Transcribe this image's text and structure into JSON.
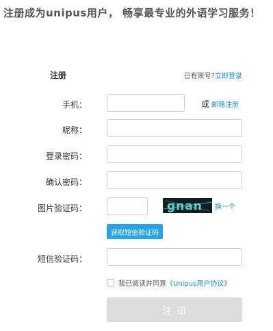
{
  "header": {
    "headline": "注册成为unipus用户， 畅享最专业的外语学习服务！"
  },
  "form": {
    "title": "注册",
    "login_hint": "已有账号?",
    "login_link": "立即登录",
    "labels": {
      "phone": "手机：",
      "nickname": "昵称：",
      "password": "登录密码：",
      "confirm": "确认密码：",
      "captcha": "图片验证码：",
      "sms": "短信验证码："
    },
    "fields": {
      "phone": {
        "value": "",
        "placeholder": ""
      },
      "nickname": {
        "value": "",
        "placeholder": ""
      },
      "password": {
        "value": "",
        "placeholder": ""
      },
      "confirm": {
        "value": "",
        "placeholder": ""
      },
      "captcha": {
        "value": "",
        "placeholder": ""
      },
      "sms": {
        "value": "",
        "placeholder": ""
      }
    },
    "or_text": "或",
    "email_register": "邮箱注册",
    "captcha_image_text": "gnan",
    "refresh_link": "换一个",
    "sms_button": "获取短信验证码",
    "agreement_prefix": "我已阅读并同意",
    "agreement_link": "《Unipus用户协议》",
    "agreement_checked": false,
    "submit": "注册"
  },
  "colors": {
    "link": "#1f8ad6",
    "sms_button": "#26a2e6",
    "submit_disabled": "#dcdcdc"
  }
}
